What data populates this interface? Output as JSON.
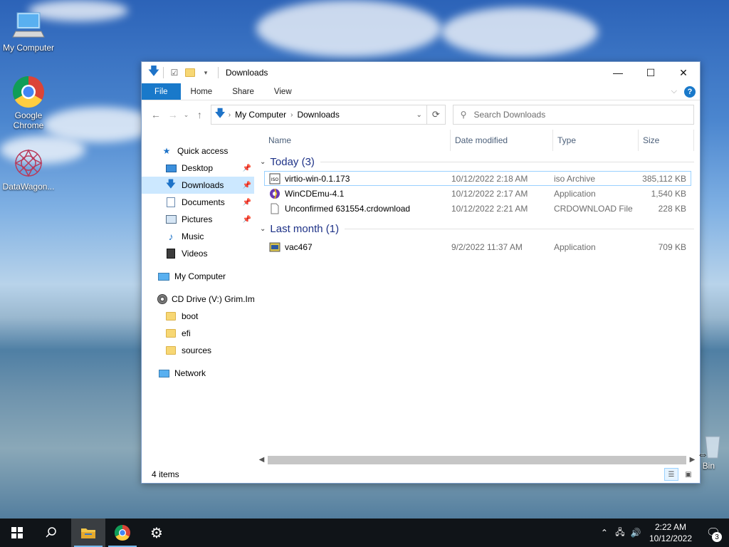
{
  "desktop": {
    "icons": [
      {
        "label": "My Computer",
        "icon": "my-computer-icon"
      },
      {
        "label": "Google Chrome",
        "icon": "chrome-icon"
      },
      {
        "label": "DataWagon...",
        "icon": "datawagon-icon"
      },
      {
        "label": "Bin",
        "icon": "recycle-bin-icon"
      }
    ]
  },
  "window": {
    "title": "Downloads",
    "controls": {
      "minimize": "—",
      "maximize": "☐",
      "close": "✕"
    },
    "ribbon_tabs": [
      "File",
      "Home",
      "Share",
      "View"
    ],
    "address": {
      "segments": [
        "My Computer",
        "Downloads"
      ]
    },
    "search": {
      "placeholder": "Search Downloads"
    },
    "sidebar": {
      "items": [
        {
          "label": "Quick access",
          "icon": "star-icon",
          "pinned": false
        },
        {
          "label": "Desktop",
          "icon": "desktop-folder-icon",
          "pinned": true
        },
        {
          "label": "Downloads",
          "icon": "downloads-folder-icon",
          "pinned": true,
          "active": true
        },
        {
          "label": "Documents",
          "icon": "documents-folder-icon",
          "pinned": true
        },
        {
          "label": "Pictures",
          "icon": "pictures-folder-icon",
          "pinned": true
        },
        {
          "label": "Music",
          "icon": "music-folder-icon",
          "pinned": false
        },
        {
          "label": "Videos",
          "icon": "videos-folder-icon",
          "pinned": false
        },
        {
          "label": "My Computer",
          "icon": "computer-icon",
          "pinned": false
        },
        {
          "label": "CD Drive (V:) Grim.Im",
          "icon": "cd-drive-icon",
          "pinned": false
        },
        {
          "label": "boot",
          "icon": "folder-icon",
          "pinned": false
        },
        {
          "label": "efi",
          "icon": "folder-icon",
          "pinned": false
        },
        {
          "label": "sources",
          "icon": "folder-icon",
          "pinned": false
        },
        {
          "label": "Network",
          "icon": "network-icon",
          "pinned": false
        }
      ]
    },
    "columns": [
      "Name",
      "Date modified",
      "Type",
      "Size"
    ],
    "groups": [
      {
        "label": "Today (3)",
        "files": [
          {
            "name": "virtio-win-0.1.173",
            "date": "10/12/2022 2:18 AM",
            "type": "iso Archive",
            "size": "385,112 KB",
            "icon": "iso-file-icon",
            "selected": true
          },
          {
            "name": "WinCDEmu-4.1",
            "date": "10/12/2022 2:17 AM",
            "type": "Application",
            "size": "1,540 KB",
            "icon": "wincdemu-app-icon",
            "selected": false
          },
          {
            "name": "Unconfirmed 631554.crdownload",
            "date": "10/12/2022 2:21 AM",
            "type": "CRDOWNLOAD File",
            "size": "228 KB",
            "icon": "blank-file-icon",
            "selected": false
          }
        ]
      },
      {
        "label": "Last month (1)",
        "files": [
          {
            "name": "vac467",
            "date": "9/2/2022 11:37 AM",
            "type": "Application",
            "size": "709 KB",
            "icon": "installer-app-icon",
            "selected": false
          }
        ]
      }
    ],
    "status": "4 items"
  },
  "taskbar": {
    "clock_time": "2:22 AM",
    "clock_date": "10/12/2022",
    "notification_count": "3"
  }
}
